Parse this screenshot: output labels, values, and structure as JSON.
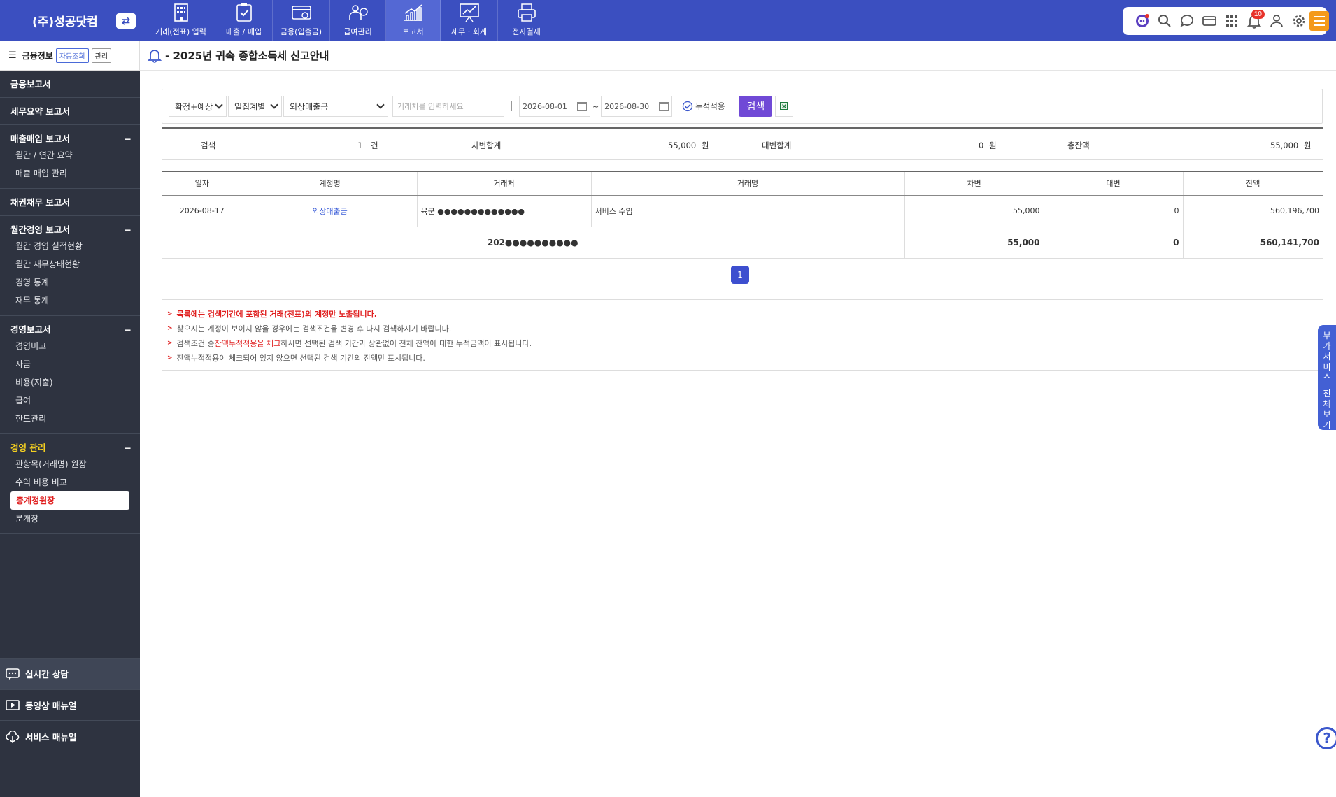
{
  "app": {
    "company": "(주)성공닷컴"
  },
  "nav": [
    {
      "label": "거래(전표) 입력",
      "icon": "building-icon",
      "active": false
    },
    {
      "label": "매출 / 매입",
      "icon": "clipboard-check-icon",
      "active": false
    },
    {
      "label": "금융(입출금)",
      "icon": "money-card-icon",
      "active": false
    },
    {
      "label": "급여관리",
      "icon": "payroll-icon",
      "active": false
    },
    {
      "label": "보고서",
      "icon": "chart-up-icon",
      "active": true
    },
    {
      "label": "세무 · 회계",
      "icon": "presentation-chart-icon",
      "active": false
    },
    {
      "label": "전자결재",
      "icon": "printer-doc-icon",
      "active": false
    }
  ],
  "toolbar": {
    "notification_count": "10",
    "icons": [
      "chatbot-icon",
      "search-icon",
      "chat-icon",
      "card-icon",
      "grid-icon",
      "bell-icon",
      "user-icon",
      "gear-icon"
    ]
  },
  "sidebar": {
    "top_label": "금융정보",
    "top_pill_auto": "자동조회",
    "top_pill_manage": "관리",
    "sections": [
      {
        "title": "금융보고서",
        "collapsible": false,
        "items": []
      },
      {
        "title": "세무요약 보고서",
        "collapsible": false,
        "items": []
      },
      {
        "title": "매출매입 보고서",
        "collapsible": true,
        "items": [
          "월간 / 연간 요약",
          "매출 매입 관리"
        ]
      },
      {
        "title": "채권채무 보고서",
        "collapsible": false,
        "items": []
      },
      {
        "title": "월간경영 보고서",
        "collapsible": true,
        "items": [
          "월간 경영 실적현황",
          "월간 재무상태현황",
          "경영 통계",
          "재무 통계"
        ]
      },
      {
        "title": "경영보고서",
        "collapsible": true,
        "items": [
          "경영비교",
          "자금",
          "비용(지출)",
          "급여",
          "한도관리"
        ]
      },
      {
        "title": "경영 관리",
        "collapsible": true,
        "highlight": true,
        "items": [
          "관항목(거래명) 원장",
          "수익 비용 비교",
          "총계정원장",
          "분개장"
        ],
        "active_item": "총계정원장"
      }
    ],
    "collapse_symbol": "−",
    "bottom": [
      {
        "label": "실시간 상담",
        "icon": "chat-support-icon"
      },
      {
        "label": "동영상 매뉴얼",
        "icon": "video-play-icon"
      },
      {
        "label": "서비스 매뉴얼",
        "icon": "cloud-download-icon"
      }
    ]
  },
  "header": {
    "title": "- 2025년 귀속 종합소득세 신고안내"
  },
  "filters": {
    "basis": "확정+예상",
    "grouping": "일집계별",
    "account": "외상매출금",
    "counterparty_placeholder": "거래처를 입력하세요",
    "date_from": "2026-08-01",
    "date_sep": "~",
    "date_to": "2026-08-30",
    "cumulative_label": "누적적용",
    "search_button": "검색"
  },
  "summary": {
    "search_label": "검색",
    "count": "1",
    "count_unit": "건",
    "debit_label": "차변합계",
    "debit_value": "55,000",
    "debit_unit": "원",
    "credit_label": "대변합계",
    "credit_value": "0",
    "credit_unit": "원",
    "balance_label": "총잔액",
    "balance_value": "55,000",
    "balance_unit": "원"
  },
  "table": {
    "columns": [
      "일자",
      "계정명",
      "거래처",
      "거래명",
      "차변",
      "대변",
      "잔액"
    ],
    "rows": [
      {
        "date": "2026-08-17",
        "account": "외상매출금",
        "counterparty": "육군 ●●●●●●●●●●●●●",
        "description": "서비스 수입",
        "debit": "55,000",
        "credit": "0",
        "balance": "560,196,700"
      }
    ],
    "total": {
      "label": "202●●●●●●●●●●",
      "debit": "55,000",
      "credit": "0",
      "balance": "560,141,700"
    }
  },
  "pagination": {
    "current": "1"
  },
  "notes": {
    "n1": "목록에는 검색기간에 포함된 거래(전표)의 계정만 노출됩니다.",
    "n2": "찾으시는 계정이 보이지 않을 경우에는 검색조건을 변경 후 다시 검색하시기 바랍니다.",
    "n3_pre": "검색조건 중 ",
    "n3_hl": "잔액누적적용을 체크",
    "n3_post": "하시면 선택된 검색 기간과 상관없이 전체 잔액에 대한 누적금액이 표시됩니다.",
    "n4": "잔액누적적용이 체크되어 있지 않으면 선택된 검색 기간의 잔액만 표시됩니다."
  },
  "side_tab": {
    "label": "부가서비스 전체보기"
  },
  "help": {
    "label": "?"
  },
  "colors": {
    "topbar": "#3b4fc0",
    "sidebar": "#2e3340",
    "accent_purple": "#7049d6",
    "highlight_yellow": "#f5d020",
    "alert_red": "#e02020"
  }
}
